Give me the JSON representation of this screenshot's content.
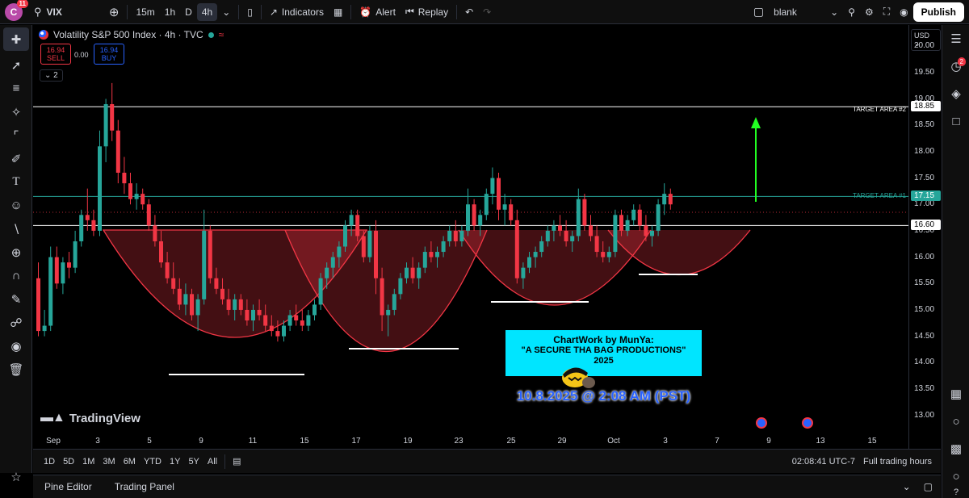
{
  "topbar": {
    "avatar_letter": "C",
    "avatar_badge": "11",
    "symbol": "VIX",
    "timeframes": [
      "15m",
      "1h",
      "D",
      "4h"
    ],
    "active_timeframe": "4h",
    "indicators_label": "Indicators",
    "alert_label": "Alert",
    "replay_label": "Replay",
    "layout_name": "blank",
    "publish_label": "Publish"
  },
  "legend": {
    "title": "Volatility S&P 500 Index · 4h · TVC",
    "sell_price": "16.94",
    "sell_label": "SELL",
    "spread": "0.00",
    "buy_price": "16.94",
    "buy_label": "BUY",
    "collapse_count": "2"
  },
  "price_axis": {
    "currency": "USD",
    "ticks": [
      "20.00",
      "19.50",
      "19.00",
      "18.50",
      "18.00",
      "17.50",
      "17.00",
      "16.50",
      "16.00",
      "15.50",
      "15.00",
      "14.50",
      "14.00",
      "13.50",
      "13.00"
    ],
    "labels": [
      {
        "value": "18.85",
        "style": "white"
      },
      {
        "value": "17.15",
        "style": "green"
      },
      {
        "value": "16.60",
        "style": "white"
      }
    ]
  },
  "time_axis": {
    "ticks": [
      "Sep",
      "3",
      "5",
      "9",
      "11",
      "15",
      "17",
      "19",
      "23",
      "25",
      "29",
      "Oct",
      "3",
      "7",
      "9",
      "13",
      "15"
    ]
  },
  "annotations": {
    "target2": "TARGET AREA #2",
    "target1": "TARGET AREA #1",
    "credit_line1": "ChartWork by MunYa:",
    "credit_line2": "\"A SECURE THA BAG PRODUCTIONS\"",
    "credit_line3": "2025",
    "datestamp": "10.8.2025 @ 2:08 AM (PST)",
    "watermark": "TradingView"
  },
  "bottombar": {
    "ranges": [
      "1D",
      "5D",
      "1M",
      "3M",
      "6M",
      "YTD",
      "1Y",
      "5Y",
      "All"
    ],
    "clock": "02:08:41 UTC-7",
    "session": "Full trading hours"
  },
  "bottomtabs": {
    "pine_editor": "Pine Editor",
    "trading_panel": "Trading Panel"
  },
  "chart_data": {
    "type": "candlestick",
    "title": "Volatility S&P 500 Index · 4h · TVC",
    "ylim": [
      12.75,
      20.4
    ],
    "levels": [
      18.85,
      17.15,
      16.6
    ],
    "ohlc": [
      [
        15.6,
        15.9,
        14.5,
        14.6
      ],
      [
        14.6,
        15.0,
        14.5,
        14.7
      ],
      [
        14.7,
        16.2,
        14.6,
        16.0
      ],
      [
        16.0,
        16.2,
        15.4,
        15.5
      ],
      [
        15.5,
        16.0,
        15.3,
        15.9
      ],
      [
        15.9,
        16.1,
        15.6,
        15.8
      ],
      [
        15.8,
        16.5,
        15.7,
        16.3
      ],
      [
        16.3,
        16.9,
        16.2,
        16.8
      ],
      [
        16.8,
        17.3,
        16.5,
        16.7
      ],
      [
        16.7,
        16.9,
        16.4,
        16.5
      ],
      [
        16.5,
        18.4,
        16.4,
        18.1
      ],
      [
        18.1,
        19.0,
        17.8,
        18.9
      ],
      [
        18.9,
        19.3,
        18.2,
        18.4
      ],
      [
        18.4,
        18.6,
        17.4,
        17.6
      ],
      [
        17.6,
        17.9,
        17.2,
        17.4
      ],
      [
        17.4,
        17.6,
        17.0,
        17.1
      ],
      [
        17.1,
        17.4,
        16.9,
        17.2
      ],
      [
        17.2,
        17.3,
        16.9,
        17.0
      ],
      [
        17.0,
        17.1,
        16.5,
        16.6
      ],
      [
        16.6,
        16.8,
        16.2,
        16.3
      ],
      [
        16.3,
        16.5,
        15.8,
        15.9
      ],
      [
        15.9,
        16.1,
        15.5,
        15.6
      ],
      [
        15.6,
        15.9,
        15.3,
        15.4
      ],
      [
        15.4,
        15.6,
        15.0,
        15.1
      ],
      [
        15.1,
        15.5,
        14.9,
        15.3
      ],
      [
        15.3,
        15.4,
        14.8,
        14.9
      ],
      [
        14.9,
        15.3,
        14.6,
        15.2
      ],
      [
        15.2,
        16.9,
        15.1,
        16.5
      ],
      [
        16.5,
        16.6,
        15.5,
        15.6
      ],
      [
        15.6,
        15.8,
        15.3,
        15.4
      ],
      [
        15.4,
        15.6,
        15.1,
        15.2
      ],
      [
        15.2,
        15.4,
        14.9,
        15.0
      ],
      [
        15.0,
        15.3,
        14.8,
        15.2
      ],
      [
        15.2,
        15.3,
        14.9,
        15.0
      ],
      [
        15.0,
        15.2,
        14.7,
        14.8
      ],
      [
        14.8,
        15.1,
        14.6,
        15.0
      ],
      [
        15.0,
        15.2,
        14.8,
        14.9
      ],
      [
        14.9,
        15.1,
        14.6,
        14.7
      ],
      [
        14.7,
        14.9,
        14.5,
        14.6
      ],
      [
        14.6,
        14.8,
        14.4,
        14.5
      ],
      [
        14.5,
        14.8,
        14.4,
        14.7
      ],
      [
        14.7,
        15.0,
        14.6,
        14.9
      ],
      [
        14.9,
        15.1,
        14.7,
        14.8
      ],
      [
        14.8,
        15.0,
        14.6,
        14.7
      ],
      [
        14.7,
        15.0,
        14.6,
        14.9
      ],
      [
        14.9,
        15.2,
        14.8,
        15.1
      ],
      [
        15.1,
        15.7,
        15.0,
        15.6
      ],
      [
        15.6,
        15.9,
        15.4,
        15.8
      ],
      [
        15.8,
        16.1,
        15.6,
        16.0
      ],
      [
        16.0,
        16.3,
        15.8,
        16.2
      ],
      [
        16.2,
        16.7,
        16.1,
        16.6
      ],
      [
        16.6,
        16.9,
        16.4,
        16.8
      ],
      [
        16.8,
        16.9,
        16.3,
        16.4
      ],
      [
        16.4,
        16.5,
        15.9,
        16.0
      ],
      [
        16.0,
        16.6,
        15.9,
        16.5
      ],
      [
        16.5,
        16.7,
        15.3,
        15.6
      ],
      [
        15.6,
        15.8,
        14.6,
        14.9
      ],
      [
        14.9,
        15.1,
        14.5,
        15.0
      ],
      [
        15.0,
        15.4,
        14.9,
        15.3
      ],
      [
        15.3,
        15.7,
        15.2,
        15.6
      ],
      [
        15.6,
        15.9,
        15.5,
        15.8
      ],
      [
        15.8,
        16.0,
        15.5,
        15.6
      ],
      [
        15.6,
        15.9,
        15.4,
        15.8
      ],
      [
        15.8,
        16.2,
        15.7,
        16.1
      ],
      [
        16.1,
        16.3,
        15.9,
        16.0
      ],
      [
        16.0,
        16.2,
        15.8,
        16.1
      ],
      [
        16.1,
        16.4,
        16.0,
        16.3
      ],
      [
        16.3,
        16.6,
        16.2,
        16.5
      ],
      [
        16.5,
        16.7,
        16.2,
        16.3
      ],
      [
        16.3,
        16.6,
        16.2,
        16.5
      ],
      [
        16.5,
        17.3,
        16.4,
        17.0
      ],
      [
        17.0,
        17.1,
        16.5,
        16.6
      ],
      [
        16.6,
        16.9,
        16.4,
        16.8
      ],
      [
        16.8,
        17.3,
        16.7,
        17.2
      ],
      [
        17.2,
        17.7,
        17.0,
        17.5
      ],
      [
        17.5,
        17.6,
        16.7,
        16.9
      ],
      [
        16.9,
        17.2,
        16.6,
        17.0
      ],
      [
        17.0,
        17.1,
        16.6,
        16.7
      ],
      [
        16.7,
        16.9,
        15.5,
        15.6
      ],
      [
        15.6,
        15.9,
        15.4,
        15.8
      ],
      [
        15.8,
        16.1,
        15.7,
        16.0
      ],
      [
        16.0,
        16.2,
        15.8,
        16.1
      ],
      [
        16.1,
        16.4,
        16.0,
        16.3
      ],
      [
        16.3,
        16.6,
        16.2,
        16.5
      ],
      [
        16.5,
        16.7,
        16.3,
        16.6
      ],
      [
        16.6,
        16.8,
        16.4,
        16.5
      ],
      [
        16.5,
        16.7,
        16.2,
        16.3
      ],
      [
        16.3,
        16.5,
        16.1,
        16.4
      ],
      [
        16.4,
        17.3,
        16.3,
        17.1
      ],
      [
        17.1,
        17.2,
        16.5,
        16.6
      ],
      [
        16.6,
        16.8,
        16.3,
        16.4
      ],
      [
        16.4,
        16.6,
        16.0,
        16.1
      ],
      [
        16.1,
        16.3,
        15.9,
        16.0
      ],
      [
        16.0,
        16.2,
        15.9,
        16.1
      ],
      [
        16.1,
        16.9,
        16.0,
        16.8
      ],
      [
        16.8,
        16.9,
        16.4,
        16.5
      ],
      [
        16.5,
        16.8,
        16.4,
        16.7
      ],
      [
        16.7,
        17.0,
        16.6,
        16.9
      ],
      [
        16.9,
        17.0,
        16.5,
        16.6
      ],
      [
        16.6,
        16.8,
        16.3,
        16.4
      ],
      [
        16.4,
        16.6,
        16.2,
        16.5
      ],
      [
        16.5,
        17.1,
        16.4,
        17.0
      ],
      [
        17.0,
        17.4,
        16.8,
        17.2
      ],
      [
        17.2,
        17.3,
        16.9,
        17.0
      ]
    ]
  }
}
